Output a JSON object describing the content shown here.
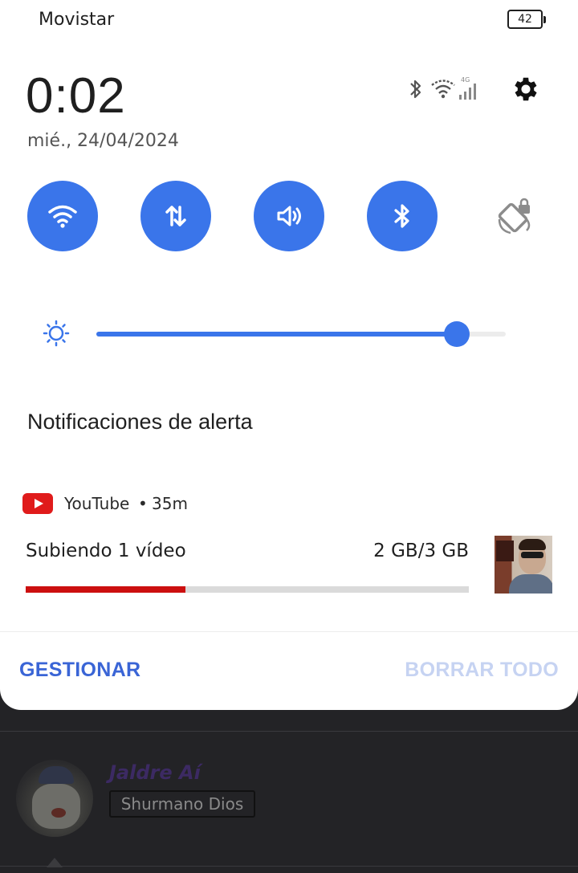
{
  "status_bar": {
    "carrier": "Movistar",
    "battery_level": "42",
    "network_type": "4G",
    "icons": [
      "bluetooth-icon",
      "wifi-icon",
      "signal-icon"
    ]
  },
  "header": {
    "time": "0:02",
    "date": "mié., 24/04/2024"
  },
  "quick_settings": [
    {
      "name": "wifi",
      "icon": "wifi-icon",
      "active": true
    },
    {
      "name": "mobile-data",
      "icon": "data-arrows-icon",
      "active": true
    },
    {
      "name": "sound",
      "icon": "speaker-icon",
      "active": true
    },
    {
      "name": "bluetooth",
      "icon": "bluetooth-icon",
      "active": true
    },
    {
      "name": "auto-rotate",
      "icon": "rotate-lock-icon",
      "active": false
    }
  ],
  "brightness": {
    "level": 0.88,
    "icon": "sun-icon"
  },
  "section": {
    "title": "Notificaciones de alerta"
  },
  "notification": {
    "app_name": "YouTube",
    "separator": "•",
    "time": "35m",
    "title": "Subiendo 1 vídeo",
    "size": "2 GB/3 GB",
    "progress": 0.36
  },
  "actions": {
    "manage_label": "GESTIONAR",
    "clear_label": "BORRAR TODO"
  },
  "background_app": {
    "user_name": "Jaldre Aí",
    "badge": "Shurmano Dios"
  },
  "colors": {
    "accent": "#3a75ea",
    "progress_red": "#cc0f0f",
    "manage_text": "#3a65d6",
    "clear_text_disabled": "#c6d3f2"
  }
}
